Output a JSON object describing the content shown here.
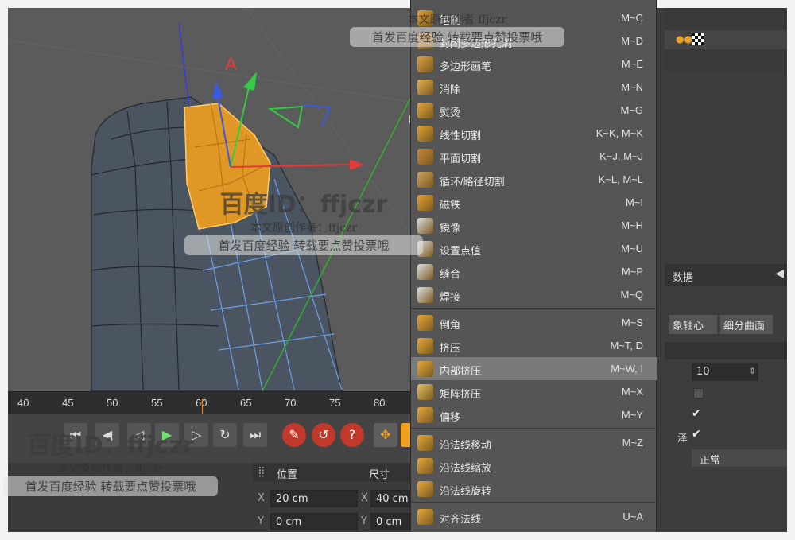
{
  "timeline": {
    "ticks": [
      "40",
      "45",
      "50",
      "55",
      "60",
      "65",
      "70",
      "75",
      "80"
    ]
  },
  "coords": {
    "header_position": "位置",
    "header_size": "尺寸",
    "rows": [
      {
        "axis": "X",
        "position": "20 cm",
        "size_axis": "X",
        "size": "40 cm"
      },
      {
        "axis": "Y",
        "position": "0 cm",
        "size_axis": "Y",
        "size": "0 cm"
      }
    ]
  },
  "menu": {
    "items": [
      {
        "label": "笔刷",
        "shortcut": "M~C",
        "icon": "brush-icon"
      },
      {
        "label": "封闭多边形孔洞",
        "shortcut": "M~D",
        "icon": "close-hole-icon"
      },
      {
        "label": "多边形画笔",
        "shortcut": "M~E",
        "icon": "polygon-pen-icon"
      },
      {
        "label": "消除",
        "shortcut": "M~N",
        "icon": "dissolve-icon"
      },
      {
        "label": "熨烫",
        "shortcut": "M~G",
        "icon": "iron-icon"
      },
      {
        "label": "线性切割",
        "shortcut": "K~K, M~K",
        "icon": "knife-line-icon"
      },
      {
        "label": "平面切割",
        "shortcut": "K~J, M~J",
        "icon": "plane-cut-icon"
      },
      {
        "label": "循环/路径切割",
        "shortcut": "K~L, M~L",
        "icon": "loop-cut-icon"
      },
      {
        "label": "磁铁",
        "shortcut": "M~I",
        "icon": "magnet-icon"
      },
      {
        "label": "镜像",
        "shortcut": "M~H",
        "icon": "mirror-icon"
      },
      {
        "label": "设置点值",
        "shortcut": "M~U",
        "icon": "set-point-icon"
      },
      {
        "label": "缝合",
        "shortcut": "M~P",
        "icon": "stitch-icon"
      },
      {
        "label": "焊接",
        "shortcut": "M~Q",
        "icon": "weld-icon"
      },
      {
        "label": "倒角",
        "shortcut": "M~S",
        "icon": "bevel-icon"
      },
      {
        "label": "挤压",
        "shortcut": "M~T, D",
        "icon": "extrude-icon"
      },
      {
        "label": "内部挤压",
        "shortcut": "M~W, I",
        "icon": "extrude-inner-icon"
      },
      {
        "label": "矩阵挤压",
        "shortcut": "M~X",
        "icon": "matrix-extrude-icon"
      },
      {
        "label": "偏移",
        "shortcut": "M~Y",
        "icon": "offset-icon"
      },
      {
        "label": "沿法线移动",
        "shortcut": "M~Z",
        "icon": "normal-move-icon"
      },
      {
        "label": "沿法线缩放",
        "shortcut": "",
        "icon": "normal-scale-icon"
      },
      {
        "label": "沿法线旋转",
        "shortcut": "",
        "icon": "normal-rotate-icon"
      },
      {
        "label": "对齐法线",
        "shortcut": "U~A",
        "icon": "align-normal-icon"
      }
    ],
    "highlighted": "内部挤压"
  },
  "right_panel": {
    "tab_label": "数据",
    "btn_axis": "象轴心",
    "btn_subdiv": "细分曲面",
    "value_field": "10",
    "partial_label": "泽",
    "partial_dropdown": "正常"
  },
  "watermarks": {
    "id_text": "百度ID：ffjczr",
    "line1": "本文原创作者：ffjczr",
    "line2": "首发百度经验 转载要点赞投票哦",
    "top_line1": "本文原创作者 ffjczr",
    "top_line2": "首发百度经验 转载要点赞投票哦"
  },
  "colors": {
    "accent_orange": "#f0a020",
    "highlight": "#7a7a7a",
    "menu_bg": "#555555"
  }
}
